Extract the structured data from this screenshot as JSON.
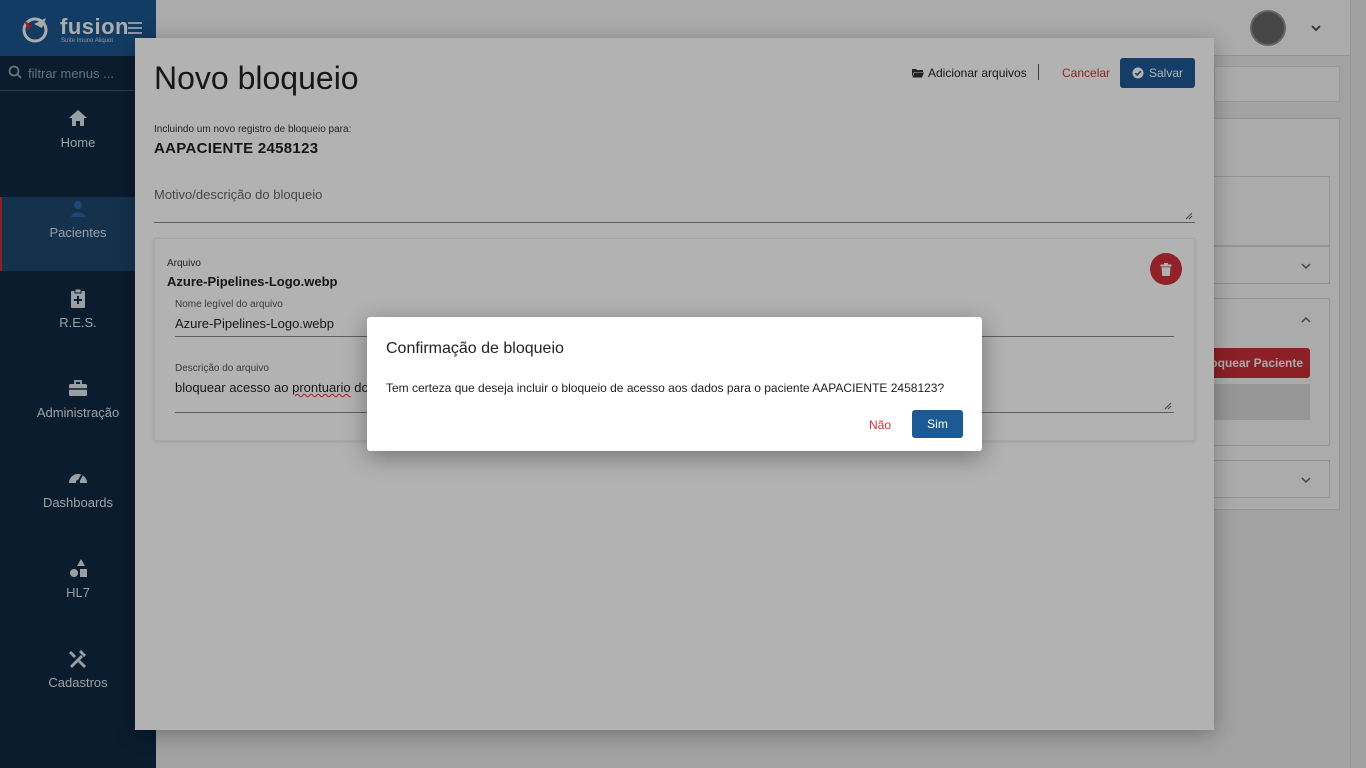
{
  "app": {
    "logo_text": "fusion",
    "logo_subtitle": "Suíte Imuno Aliquot",
    "filter_placeholder": "filtrar menus ..."
  },
  "sidebar": {
    "items": [
      {
        "label": "Home",
        "icon": "home-icon",
        "active": false
      },
      {
        "label": "Pacientes",
        "icon": "user-icon",
        "active": true
      },
      {
        "label": "R.E.S.",
        "icon": "clipboard-icon",
        "active": false
      },
      {
        "label": "Administração",
        "icon": "briefcase-icon",
        "active": false
      },
      {
        "label": "Dashboards",
        "icon": "dashboard-icon",
        "active": false
      },
      {
        "label": "HL7",
        "icon": "shapes-icon",
        "active": false
      },
      {
        "label": "Cadastros",
        "icon": "tools-icon",
        "active": false
      }
    ]
  },
  "background": {
    "block_patient_button": "loquear Paciente"
  },
  "modal": {
    "title": "Novo bloqueio",
    "add_files_label": "Adicionar arquivos",
    "cancel_label": "Cancelar",
    "save_label": "Salvar",
    "including_label": "Incluindo um novo registro de bloqueio para:",
    "patient_name": "AAPACIENTE 2458123",
    "reason_placeholder": "Motivo/descrição do bloqueio",
    "file": {
      "label": "Arquivo",
      "name": "Azure-Pipelines-Logo.webp",
      "legible_name_label": "Nome legível do arquivo",
      "legible_name_value": "Azure-Pipelines-Logo.webp",
      "description_label": "Descrição do arquivo",
      "description_value_start": "bloquear acesso ao ",
      "description_value_misspelled": "prontuario",
      "description_value_end": " do"
    }
  },
  "confirm_dialog": {
    "title": "Confirmação de bloqueio",
    "message": "Tem certeza que deseja incluir o bloqueio de acesso aos dados para o paciente AAPACIENTE 2458123?",
    "no_label": "Não",
    "yes_label": "Sim"
  },
  "colors": {
    "primary": "#1d5a95",
    "danger": "#d1303b",
    "sidebar_bg": "#0f2b45"
  }
}
